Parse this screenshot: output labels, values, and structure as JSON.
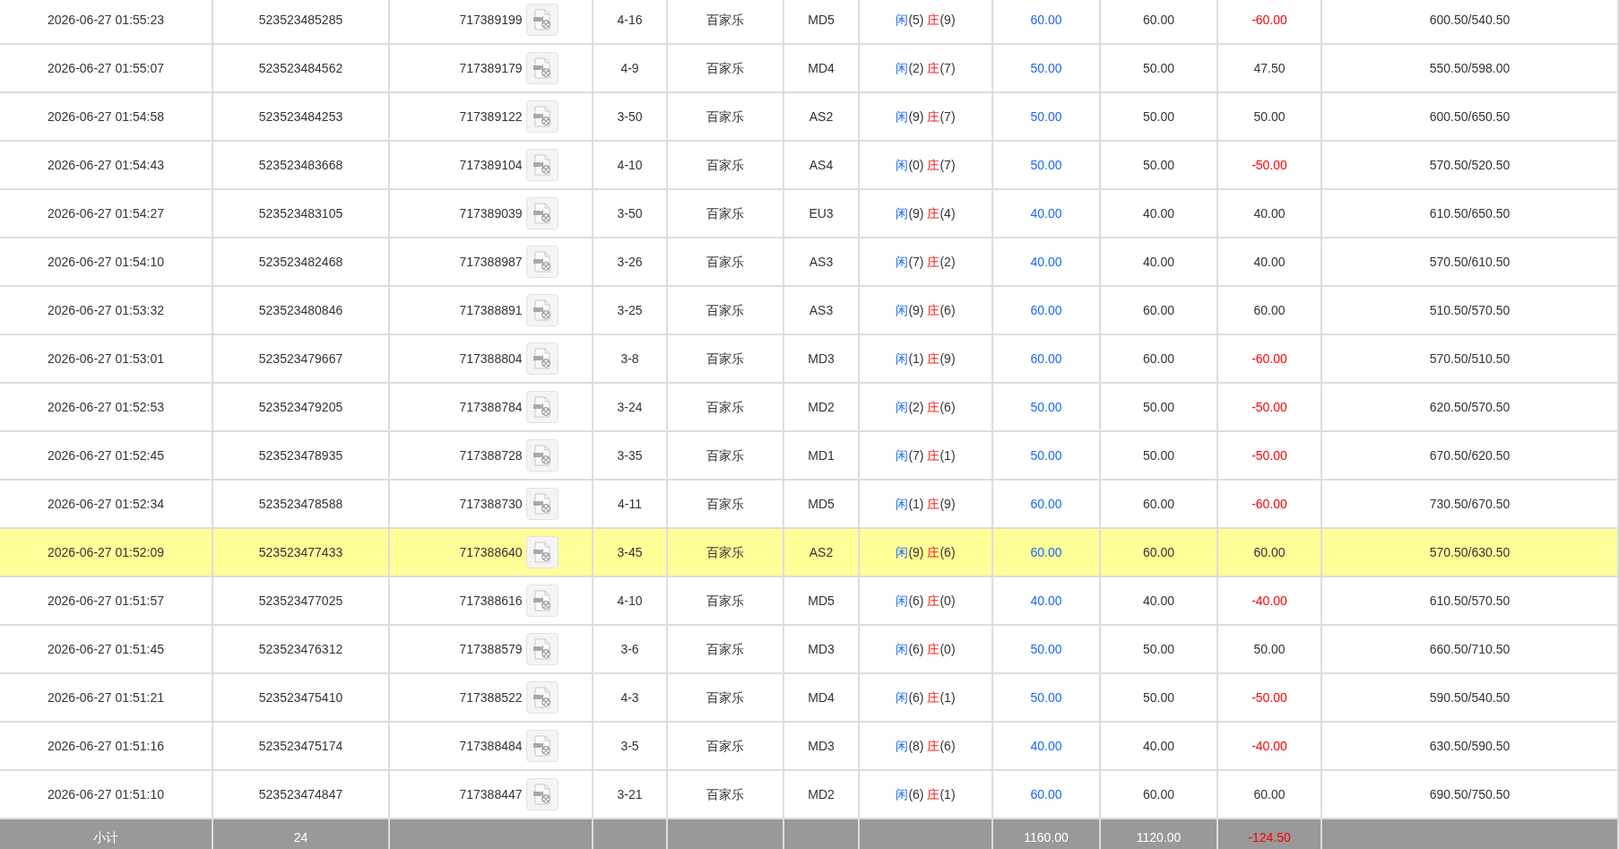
{
  "rows": [
    {
      "time": "2026-06-27 01:55:23",
      "bet_id": "523523485285",
      "round_id": "717389199",
      "shoe": "4-16",
      "game": "百家乐",
      "table": "MD5",
      "player": "闲",
      "player_score": "(5)",
      "banker": "庄",
      "banker_score": "(9)",
      "bet": "60.00",
      "valid_bet": "60.00",
      "win_loss": "-60.00",
      "loss": true,
      "balance": "600.50/540.50",
      "selected": false
    },
    {
      "time": "2026-06-27 01:55:07",
      "bet_id": "523523484562",
      "round_id": "717389179",
      "shoe": "4-9",
      "game": "百家乐",
      "table": "MD4",
      "player": "闲",
      "player_score": "(2)",
      "banker": "庄",
      "banker_score": "(7)",
      "bet": "50.00",
      "valid_bet": "50.00",
      "win_loss": "47.50",
      "loss": false,
      "balance": "550.50/598.00",
      "selected": false
    },
    {
      "time": "2026-06-27 01:54:58",
      "bet_id": "523523484253",
      "round_id": "717389122",
      "shoe": "3-50",
      "game": "百家乐",
      "table": "AS2",
      "player": "闲",
      "player_score": "(9)",
      "banker": "庄",
      "banker_score": "(7)",
      "bet": "50.00",
      "valid_bet": "50.00",
      "win_loss": "50.00",
      "loss": false,
      "balance": "600.50/650.50",
      "selected": false
    },
    {
      "time": "2026-06-27 01:54:43",
      "bet_id": "523523483668",
      "round_id": "717389104",
      "shoe": "4-10",
      "game": "百家乐",
      "table": "AS4",
      "player": "闲",
      "player_score": "(0)",
      "banker": "庄",
      "banker_score": "(7)",
      "bet": "50.00",
      "valid_bet": "50.00",
      "win_loss": "-50.00",
      "loss": true,
      "balance": "570.50/520.50",
      "selected": false
    },
    {
      "time": "2026-06-27 01:54:27",
      "bet_id": "523523483105",
      "round_id": "717389039",
      "shoe": "3-50",
      "game": "百家乐",
      "table": "EU3",
      "player": "闲",
      "player_score": "(9)",
      "banker": "庄",
      "banker_score": "(4)",
      "bet": "40.00",
      "valid_bet": "40.00",
      "win_loss": "40.00",
      "loss": false,
      "balance": "610.50/650.50",
      "selected": false
    },
    {
      "time": "2026-06-27 01:54:10",
      "bet_id": "523523482468",
      "round_id": "717388987",
      "shoe": "3-26",
      "game": "百家乐",
      "table": "AS3",
      "player": "闲",
      "player_score": "(7)",
      "banker": "庄",
      "banker_score": "(2)",
      "bet": "40.00",
      "valid_bet": "40.00",
      "win_loss": "40.00",
      "loss": false,
      "balance": "570.50/610.50",
      "selected": false
    },
    {
      "time": "2026-06-27 01:53:32",
      "bet_id": "523523480846",
      "round_id": "717388891",
      "shoe": "3-25",
      "game": "百家乐",
      "table": "AS3",
      "player": "闲",
      "player_score": "(9)",
      "banker": "庄",
      "banker_score": "(6)",
      "bet": "60.00",
      "valid_bet": "60.00",
      "win_loss": "60.00",
      "loss": false,
      "balance": "510.50/570.50",
      "selected": false
    },
    {
      "time": "2026-06-27 01:53:01",
      "bet_id": "523523479667",
      "round_id": "717388804",
      "shoe": "3-8",
      "game": "百家乐",
      "table": "MD3",
      "player": "闲",
      "player_score": "(1)",
      "banker": "庄",
      "banker_score": "(9)",
      "bet": "60.00",
      "valid_bet": "60.00",
      "win_loss": "-60.00",
      "loss": true,
      "balance": "570.50/510.50",
      "selected": false
    },
    {
      "time": "2026-06-27 01:52:53",
      "bet_id": "523523479205",
      "round_id": "717388784",
      "shoe": "3-24",
      "game": "百家乐",
      "table": "MD2",
      "player": "闲",
      "player_score": "(2)",
      "banker": "庄",
      "banker_score": "(6)",
      "bet": "50.00",
      "valid_bet": "50.00",
      "win_loss": "-50.00",
      "loss": true,
      "balance": "620.50/570.50",
      "selected": false
    },
    {
      "time": "2026-06-27 01:52:45",
      "bet_id": "523523478935",
      "round_id": "717388728",
      "shoe": "3-35",
      "game": "百家乐",
      "table": "MD1",
      "player": "闲",
      "player_score": "(7)",
      "banker": "庄",
      "banker_score": "(1)",
      "bet": "50.00",
      "valid_bet": "50.00",
      "win_loss": "-50.00",
      "loss": true,
      "balance": "670.50/620.50",
      "selected": false
    },
    {
      "time": "2026-06-27 01:52:34",
      "bet_id": "523523478588",
      "round_id": "717388730",
      "shoe": "4-11",
      "game": "百家乐",
      "table": "MD5",
      "player": "闲",
      "player_score": "(1)",
      "banker": "庄",
      "banker_score": "(9)",
      "bet": "60.00",
      "valid_bet": "60.00",
      "win_loss": "-60.00",
      "loss": true,
      "balance": "730.50/670.50",
      "selected": false
    },
    {
      "time": "2026-06-27 01:52:09",
      "bet_id": "523523477433",
      "round_id": "717388640",
      "shoe": "3-45",
      "game": "百家乐",
      "table": "AS2",
      "player": "闲",
      "player_score": "(9)",
      "banker": "庄",
      "banker_score": "(6)",
      "bet": "60.00",
      "valid_bet": "60.00",
      "win_loss": "60.00",
      "loss": false,
      "balance": "570.50/630.50",
      "selected": true
    },
    {
      "time": "2026-06-27 01:51:57",
      "bet_id": "523523477025",
      "round_id": "717388616",
      "shoe": "4-10",
      "game": "百家乐",
      "table": "MD5",
      "player": "闲",
      "player_score": "(6)",
      "banker": "庄",
      "banker_score": "(0)",
      "bet": "40.00",
      "valid_bet": "40.00",
      "win_loss": "-40.00",
      "loss": true,
      "balance": "610.50/570.50",
      "selected": false
    },
    {
      "time": "2026-06-27 01:51:45",
      "bet_id": "523523476312",
      "round_id": "717388579",
      "shoe": "3-6",
      "game": "百家乐",
      "table": "MD3",
      "player": "闲",
      "player_score": "(6)",
      "banker": "庄",
      "banker_score": "(0)",
      "bet": "50.00",
      "valid_bet": "50.00",
      "win_loss": "50.00",
      "loss": false,
      "balance": "660.50/710.50",
      "selected": false
    },
    {
      "time": "2026-06-27 01:51:21",
      "bet_id": "523523475410",
      "round_id": "717388522",
      "shoe": "4-3",
      "game": "百家乐",
      "table": "MD4",
      "player": "闲",
      "player_score": "(6)",
      "banker": "庄",
      "banker_score": "(1)",
      "bet": "50.00",
      "valid_bet": "50.00",
      "win_loss": "-50.00",
      "loss": true,
      "balance": "590.50/540.50",
      "selected": false
    },
    {
      "time": "2026-06-27 01:51:16",
      "bet_id": "523523475174",
      "round_id": "717388484",
      "shoe": "3-5",
      "game": "百家乐",
      "table": "MD3",
      "player": "闲",
      "player_score": "(8)",
      "banker": "庄",
      "banker_score": "(6)",
      "bet": "40.00",
      "valid_bet": "40.00",
      "win_loss": "-40.00",
      "loss": true,
      "balance": "630.50/590.50",
      "selected": false
    },
    {
      "time": "2026-06-27 01:51:10",
      "bet_id": "523523474847",
      "round_id": "717388447",
      "shoe": "3-21",
      "game": "百家乐",
      "table": "MD2",
      "player": "闲",
      "player_score": "(6)",
      "banker": "庄",
      "banker_score": "(1)",
      "bet": "60.00",
      "valid_bet": "60.00",
      "win_loss": "60.00",
      "loss": false,
      "balance": "690.50/750.50",
      "selected": false
    }
  ],
  "subtotal": {
    "label": "小计",
    "count": "24",
    "bet": "1160.00",
    "valid_bet": "1120.00",
    "win_loss": "-124.50",
    "loss": true
  }
}
